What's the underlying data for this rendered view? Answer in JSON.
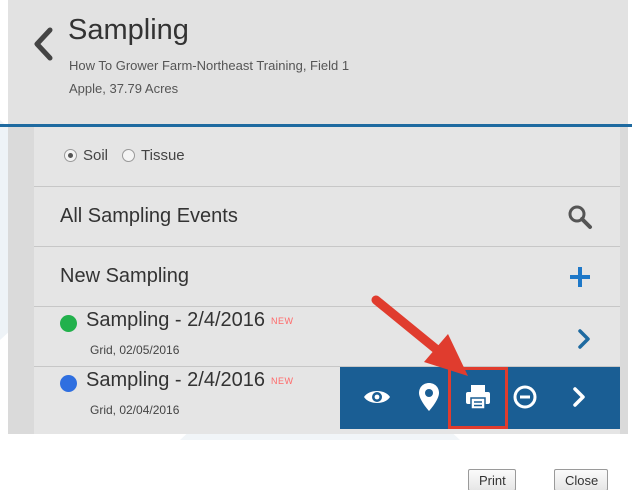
{
  "header": {
    "title": "Sampling",
    "farm_line": "How To Grower Farm-Northeast Training, Field 1",
    "crop_line": "Apple, 37.79 Acres"
  },
  "sample_type": {
    "options": [
      {
        "label": "Soil",
        "selected": true
      },
      {
        "label": "Tissue",
        "selected": false
      }
    ]
  },
  "list": {
    "all_events_label": "All Sampling Events",
    "new_sampling_label": "New Sampling",
    "events": [
      {
        "title": "Sampling - 2/4/2016",
        "badge": "NEW",
        "subtitle": "Grid, 02/05/2016",
        "status_color": "#22b14c"
      },
      {
        "title": "Sampling - 2/4/2016",
        "badge": "NEW",
        "subtitle": "Grid, 02/04/2016",
        "status_color": "#2f6fe0"
      }
    ]
  },
  "actions": [
    "eye-icon",
    "map-pin-icon",
    "print-icon",
    "minus-circle-icon",
    "chevron-right-icon"
  ],
  "footer": {
    "print_label": "Print",
    "close_label": "Close"
  },
  "colors": {
    "accent": "#1a5e94",
    "plus": "#1e78c8",
    "highlight": "#e03c2e"
  }
}
